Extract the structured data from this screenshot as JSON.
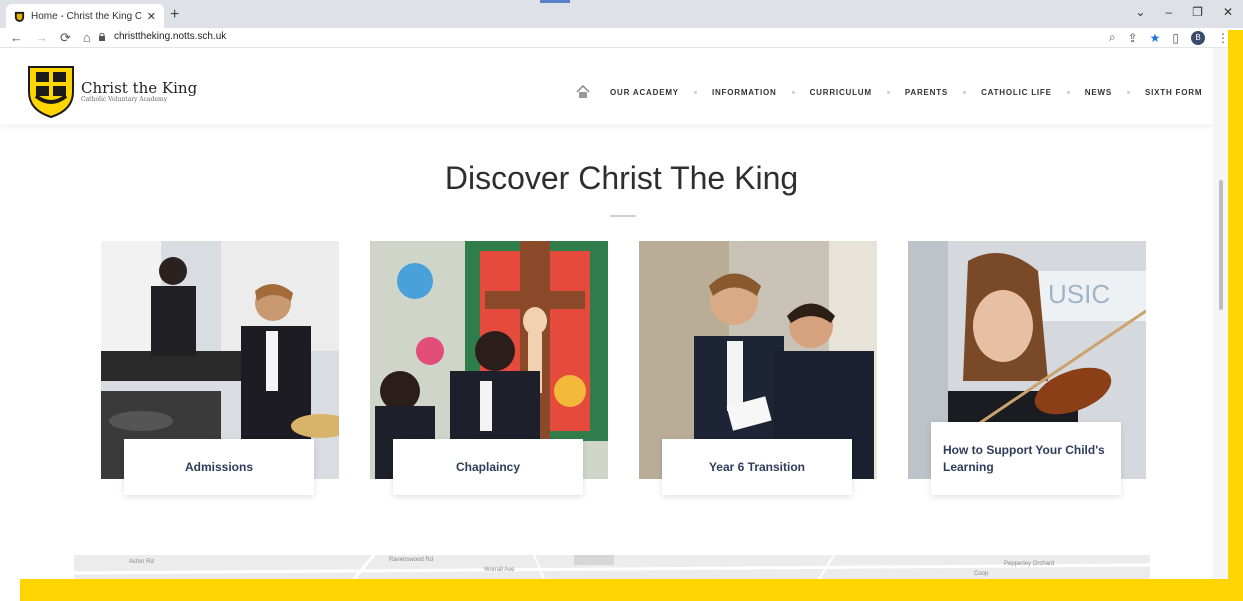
{
  "browser": {
    "tab_title": "Home - Christ the King Catholic",
    "tab_close": "✕",
    "new_tab": "+",
    "url": "christtheking.notts.sch.uk",
    "profile_initial": "B",
    "window_controls": [
      "⌄",
      "–",
      "❐",
      "✕"
    ]
  },
  "site": {
    "brand_name": "Christ the King",
    "brand_sub": "Catholic Voluntary Academy",
    "nav": [
      "OUR ACADEMY",
      "INFORMATION",
      "CURRICULUM",
      "PARENTS",
      "CATHOLIC LIFE",
      "NEWS",
      "SIXTH FORM"
    ]
  },
  "main": {
    "title": "Discover Christ The King",
    "cards": [
      {
        "label": "Admissions"
      },
      {
        "label": "Chaplaincy"
      },
      {
        "label": "Year 6 Transition"
      },
      {
        "label": "How to Support Your Child's Learning"
      }
    ]
  },
  "map": {
    "roads": [
      "Acton Rd",
      "Ravenswood Rd",
      "Worrall Ave",
      "Pepperley Orchard",
      "Coop"
    ]
  },
  "colors": {
    "accent_yellow": "#ffd500",
    "label_navy": "#2f3d5a"
  }
}
